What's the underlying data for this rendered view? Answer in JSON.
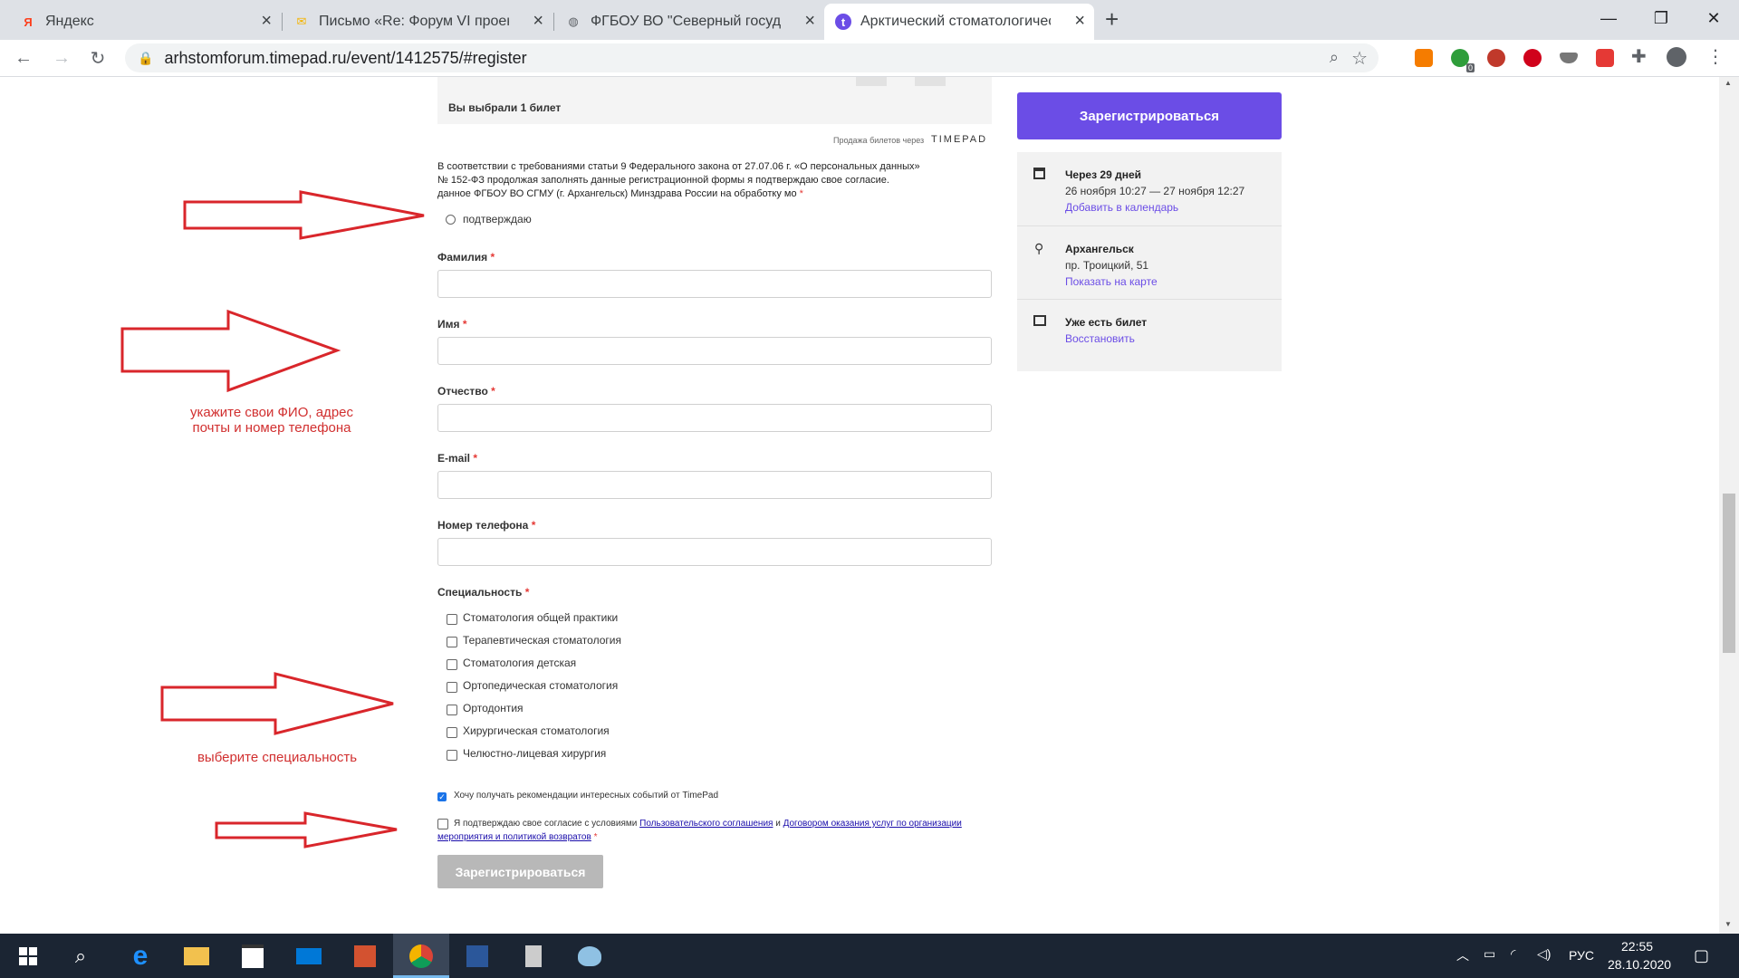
{
  "browser": {
    "tabs": [
      {
        "title": "Яндекс",
        "favicon_char": "Я",
        "favicon_color": "#fc3f1d"
      },
      {
        "title": "Письмо «Re: Форум VI проект и",
        "favicon_char": "✉",
        "favicon_color": "#f4b400"
      },
      {
        "title": "ФГБОУ ВО \"Северный государс",
        "favicon_char": "◍",
        "favicon_color": "#5f6368"
      },
      {
        "title": "Арктический стоматологически",
        "favicon_char": "t",
        "favicon_color": "#6b4de6"
      }
    ],
    "new_tab": "+",
    "url": "arhstomforum.timepad.ru/event/1412575/#register",
    "extension_badge": "0"
  },
  "form": {
    "ticket_summary": "Вы выбрали 1 билет",
    "sold_via": "Продажа билетов через",
    "sold_via_brand": "TIMEPAD",
    "consent_text_1": "В соответствии с требованиями статьи 9 Федерального закона от 27.07.06 г. «О персональных данных»",
    "consent_text_2": "№ 152-ФЗ продолжая заполнять данные регистрационной формы я подтверждаю свое согласие.",
    "consent_text_3": "данное ФГБОУ ВО СГМУ (г. Архангельск) Минздрава России на обработку мо",
    "confirm_option": "подтверждаю",
    "required_mark": "*",
    "fields": {
      "surname": "Фамилия",
      "name": "Имя",
      "patronymic": "Отчество",
      "email": "E-mail",
      "phone": "Номер телефона"
    },
    "specialty_label": "Специальность",
    "specialties": [
      "Стоматология общей практики",
      "Терапевтическая стоматология",
      "Стоматология детская",
      "Ортопедическая стоматология",
      "Ортодонтия",
      "Хирургическая стоматология",
      "Челюстно-лицевая хирургия"
    ],
    "recommendations": "Хочу получать рекомендации интересных событий от TimePad",
    "recommendations_checked": true,
    "agreement_prefix": "Я подтверждаю свое согласие с условиями",
    "agreement_link1": "Пользовательского соглашения",
    "agreement_and": "и",
    "agreement_link2": "Договором оказания услуг по организации мероприятия и политикой возвратов",
    "submit": "Зарегистрироваться"
  },
  "sidebar": {
    "register_button": "Зарегистрироваться",
    "date_title": "Через 29 дней",
    "date_range": "26 ноября 10:27 — 27 ноября 12:27",
    "add_calendar": "Добавить в календарь",
    "city": "Архангельск",
    "address": "пр. Троицкий, 51",
    "show_map": "Показать на карте",
    "ticket_title": "Уже есть билет",
    "restore": "Восстановить",
    "accent_color": "#6b4de6"
  },
  "annotations": {
    "fio_hint_1": "укажите свои ФИО, адрес",
    "fio_hint_2": "почты и номер телефона",
    "specialty_hint": "выберите специальность"
  },
  "taskbar": {
    "lang": "РУС",
    "time": "22:55",
    "date": "28.10.2020"
  }
}
